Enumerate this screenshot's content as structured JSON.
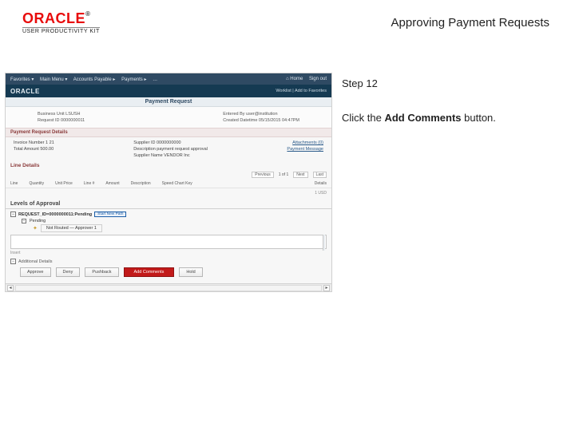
{
  "header": {
    "logo_text": "ORACLE",
    "logo_sub": "USER PRODUCTIVITY KIT",
    "doc_title": "Approving Payment Requests"
  },
  "instructions": {
    "step_label": "Step 12",
    "line_pre": "Click the ",
    "line_bold": "Add Comments",
    "line_post": " button."
  },
  "screenshot": {
    "topbar": {
      "fav": "Favorites ▾",
      "menu": "Main Menu ▾",
      "crumb1": "Accounts Payable ▸",
      "crumb2": "Payments ▸",
      "crumb3": "…",
      "home": "⌂ Home",
      "signout": "Sign out"
    },
    "subbar": {
      "brand": "ORACLE",
      "crumb": "Worklist | Add to Favorites"
    },
    "page_title": "Payment Request",
    "meta_left": {
      "a": "Business Unit  LSUSH",
      "b": "Request ID  0000000011"
    },
    "meta_right": {
      "a": "Entered By  user@institution",
      "b": "Created Datetime  05/15/2015 04:47PM"
    },
    "prb_head": "Payment Request Details",
    "prb_left": {
      "a": "Invoice Number 1 21",
      "b": "Total Amount  500.00"
    },
    "prb_mid": {
      "a": "Supplier ID  0000000000",
      "b": "Description  payment request approval",
      "c": "Supplier Name  VENDOR Inc"
    },
    "prb_right": {
      "a": "Attachments (0)",
      "b": "Payment Message"
    },
    "line_head": "Line Details",
    "line_cols": [
      "Line",
      "Quantity",
      "Unit Price",
      "Line #",
      "Amount",
      "Description",
      "Speed Chart Key",
      "Details"
    ],
    "nav": {
      "prev": "Previous",
      "of": "1  of 1",
      "next": "Next",
      "last": "Last"
    },
    "loa_head": "Levels of Approval",
    "tree": {
      "req": "REQUEST_ID=0000000011:Pending",
      "pill": "Start New Path",
      "pend": "Pending",
      "route": "Not Routed",
      "approver": "Approver 1"
    },
    "ghost": "Insert",
    "decision_label": "Additional Details",
    "actions": {
      "approve": "Approve",
      "deny": "Deny",
      "pushback": "Pushback",
      "add_comments": "Add Comments",
      "hold": "Hold"
    }
  }
}
